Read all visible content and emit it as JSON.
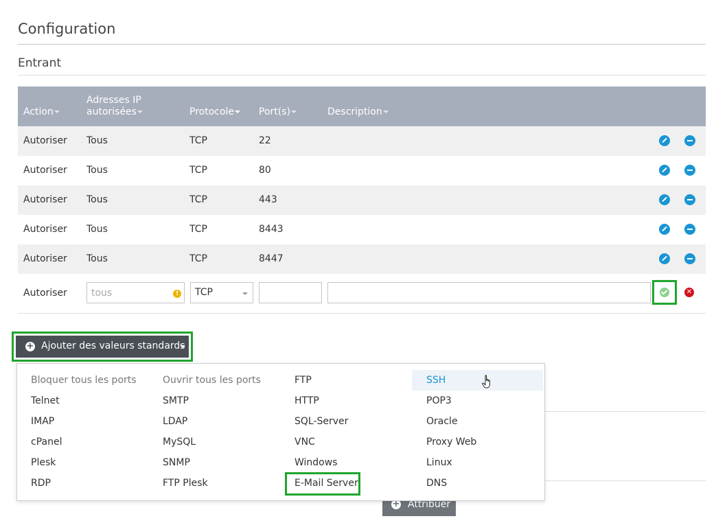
{
  "page": {
    "title": "Configuration",
    "section": "Entrant"
  },
  "table": {
    "headers": {
      "action": "Action",
      "ip_line1": "Adresses IP",
      "ip_line2": "autorisées",
      "protocol": "Protocole",
      "ports": "Port(s)",
      "description": "Description"
    },
    "rows": [
      {
        "action": "Autoriser",
        "ip": "Tous",
        "protocol": "TCP",
        "port": "22"
      },
      {
        "action": "Autoriser",
        "ip": "Tous",
        "protocol": "TCP",
        "port": "80"
      },
      {
        "action": "Autoriser",
        "ip": "Tous",
        "protocol": "TCP",
        "port": "443"
      },
      {
        "action": "Autoriser",
        "ip": "Tous",
        "protocol": "TCP",
        "port": "8443"
      },
      {
        "action": "Autoriser",
        "ip": "Tous",
        "protocol": "TCP",
        "port": "8447"
      }
    ],
    "new_row": {
      "action": "Autoriser",
      "ip_placeholder": "tous",
      "protocol": "TCP",
      "port_value": "",
      "description_value": ""
    }
  },
  "standards_button": {
    "label": "Ajouter des valeurs standards"
  },
  "dropdown": {
    "items": [
      [
        "Bloquer tous les ports",
        "Ouvrir tous les ports",
        "FTP",
        "SSH"
      ],
      [
        "Telnet",
        "SMTP",
        "HTTP",
        "POP3"
      ],
      [
        "IMAP",
        "LDAP",
        "SQL-Server",
        "Oracle"
      ],
      [
        "cPanel",
        "MySQL",
        "VNC",
        "Proxy Web"
      ],
      [
        "Plesk",
        "SNMP",
        "Windows",
        "Linux"
      ],
      [
        "RDP",
        "FTP Plesk",
        "E-Mail Server",
        "DNS"
      ]
    ],
    "hovered": "SSH",
    "highlighted": "E-Mail Server"
  },
  "attribuer_button": {
    "label": "Attribuer"
  },
  "colors": {
    "header_bg": "#a6adbb",
    "accent": "#1a95d3",
    "highlight_box": "#1fa52e",
    "danger": "#d0141e"
  },
  "icons": {
    "edit": "pencil-icon",
    "remove": "minus-circle-icon",
    "confirm": "check-icon",
    "cancel": "x-icon",
    "warning": "exclamation-icon",
    "add": "plus-circle-icon",
    "cursor": "hand-pointer-icon"
  }
}
